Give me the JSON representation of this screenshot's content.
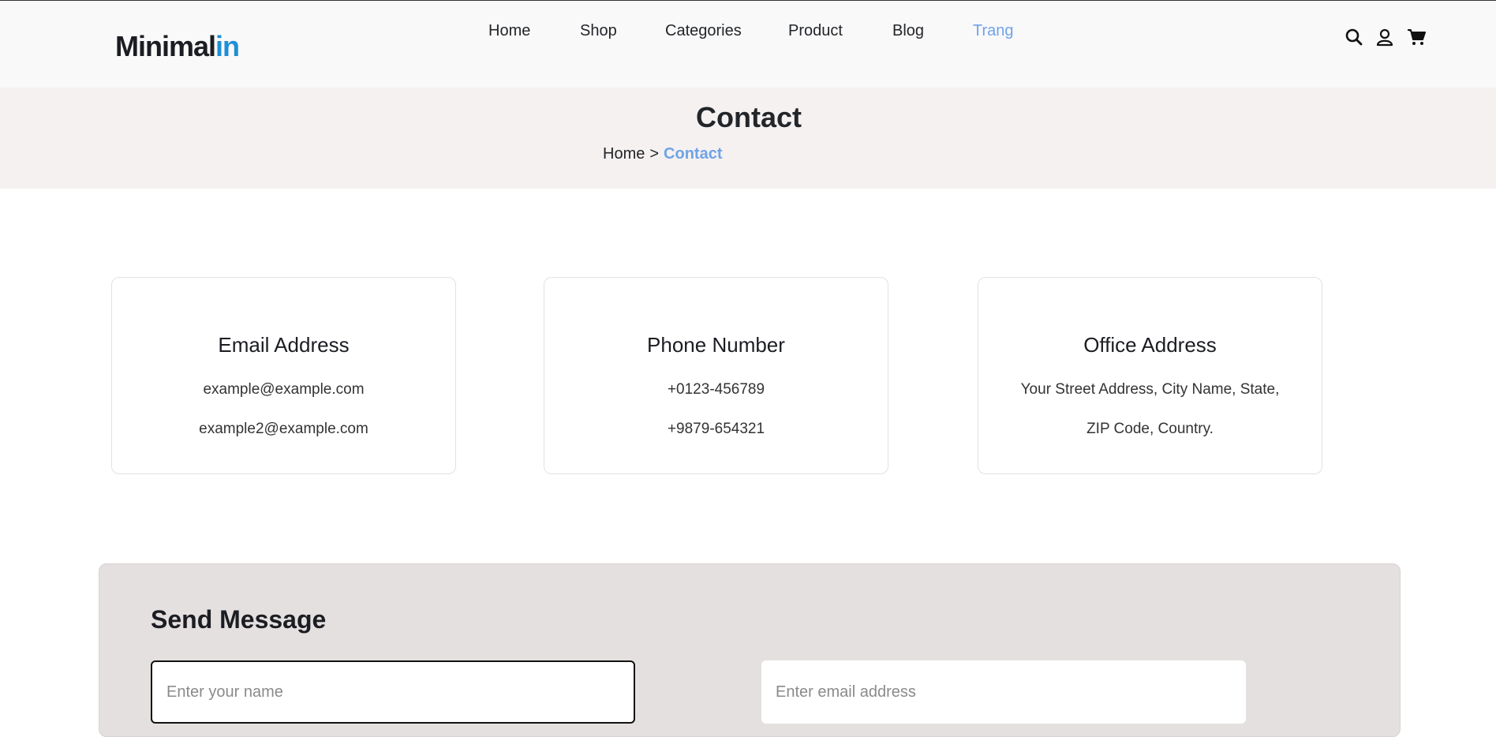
{
  "header": {
    "logo_main": "Minimal",
    "logo_accent": "in",
    "nav": [
      "Home",
      "Shop",
      "Categories",
      "Product",
      "Blog",
      "Trang"
    ],
    "active_nav": "Trang",
    "icons": [
      "search-icon",
      "user-icon",
      "cart-icon"
    ]
  },
  "banner": {
    "title": "Contact",
    "breadcrumb_home": "Home",
    "breadcrumb_sep": ">",
    "breadcrumb_current": "Contact"
  },
  "cards": [
    {
      "title": "Email Address",
      "line1": "example@example.com",
      "line2": "example2@example.com"
    },
    {
      "title": "Phone Number",
      "line1": "+0123-456789",
      "line2": "+9879-654321"
    },
    {
      "title": "Office Address",
      "line1": "Your Street Address, City Name, State,",
      "line2": "ZIP Code, Country."
    }
  ],
  "form": {
    "title": "Send Message",
    "name_placeholder": "Enter your name",
    "email_placeholder": "Enter email address"
  },
  "colors": {
    "accent": "#6fa3e8",
    "logo_accent": "#1e8fd6",
    "banner_bg": "#f5f1f0",
    "form_bg": "#e5e0e0"
  }
}
